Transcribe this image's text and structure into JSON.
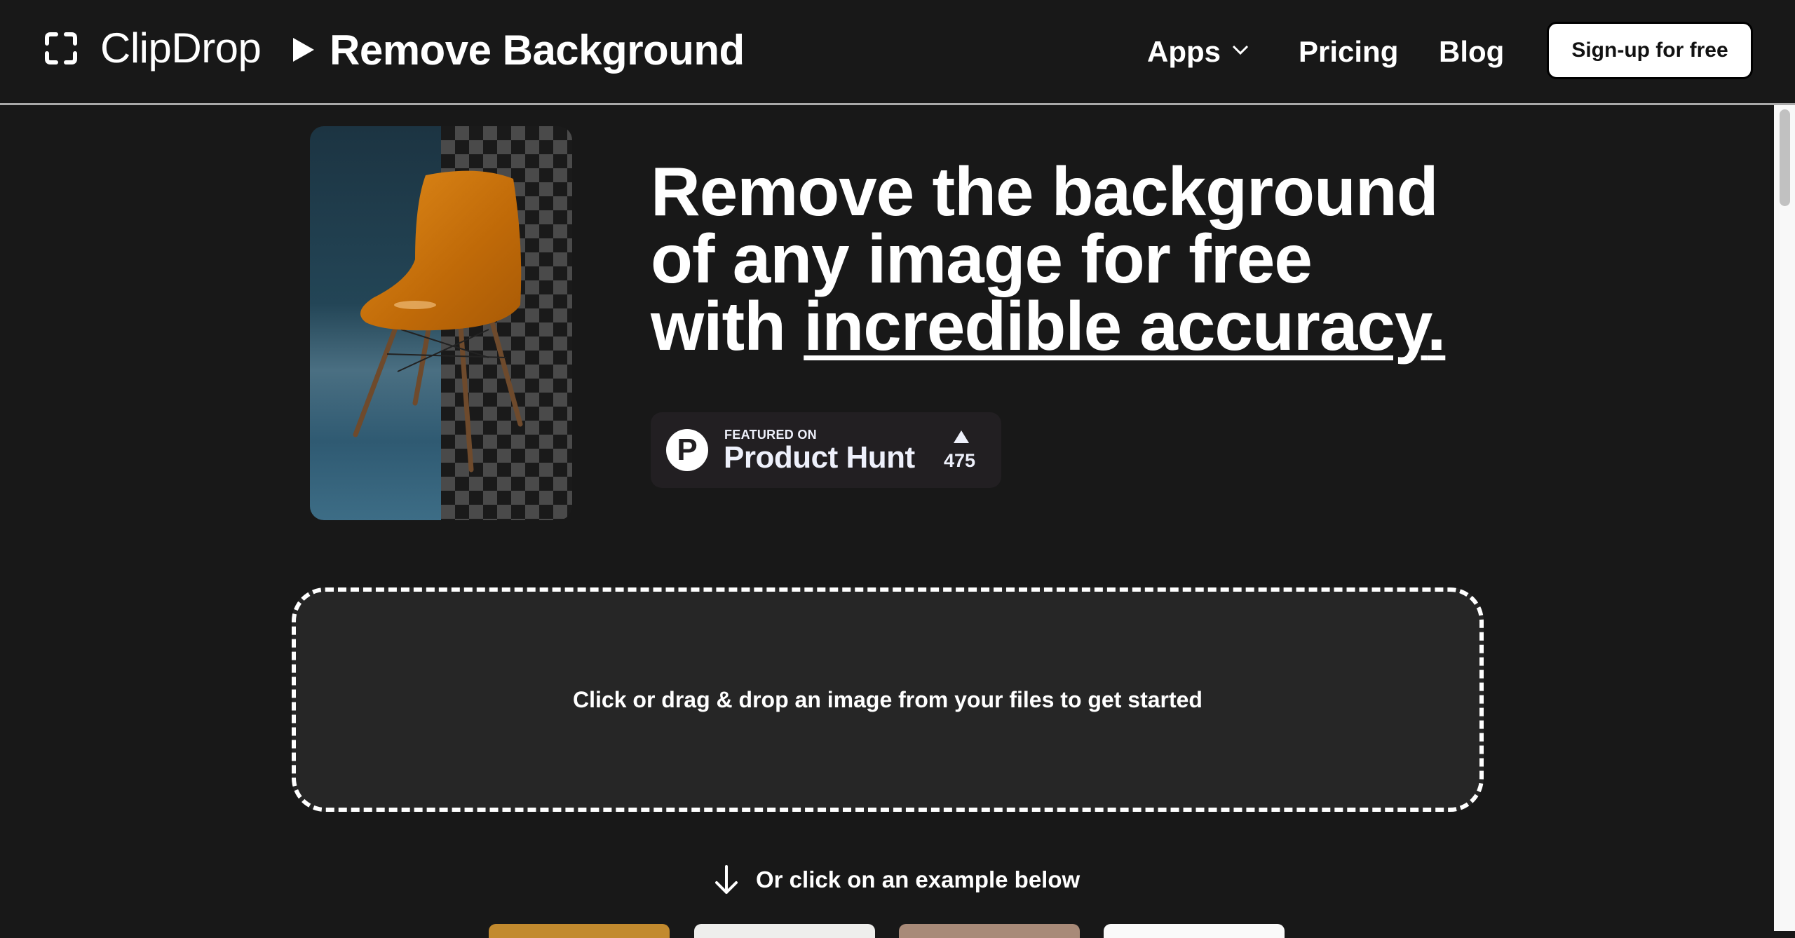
{
  "header": {
    "logo_icon": "crop-frame-icon",
    "brand": "ClipDrop",
    "separator_icon": "triangle-right-icon",
    "page_name": "Remove Background",
    "nav": [
      {
        "label": "Apps",
        "has_dropdown": true
      },
      {
        "label": "Pricing"
      },
      {
        "label": "Blog"
      }
    ],
    "signup_label": "Sign-up for free"
  },
  "hero": {
    "image_alt": "Orange chair with background partially removed",
    "headline_line1": "Remove the background",
    "headline_line2": "of any image for free",
    "headline_line3_prefix": "with ",
    "headline_emphasis": "incredible accuracy",
    "headline_suffix": ".",
    "badge": {
      "featured_on": "FEATURED ON",
      "name": "Product Hunt",
      "logo_letter": "P",
      "upvote_icon": "triangle-up-icon",
      "votes": "475"
    }
  },
  "dropzone": {
    "text": "Click or drag & drop an image from your files to get started"
  },
  "examples": {
    "hint_icon": "arrow-down-icon",
    "hint": "Or click on an example below",
    "thumbnails": [
      "example-1",
      "example-2",
      "example-3",
      "example-4"
    ]
  },
  "colors": {
    "background": "#181818",
    "dropzone_bg": "#262626",
    "badge_bg": "#221f22",
    "text": "#ffffff"
  }
}
